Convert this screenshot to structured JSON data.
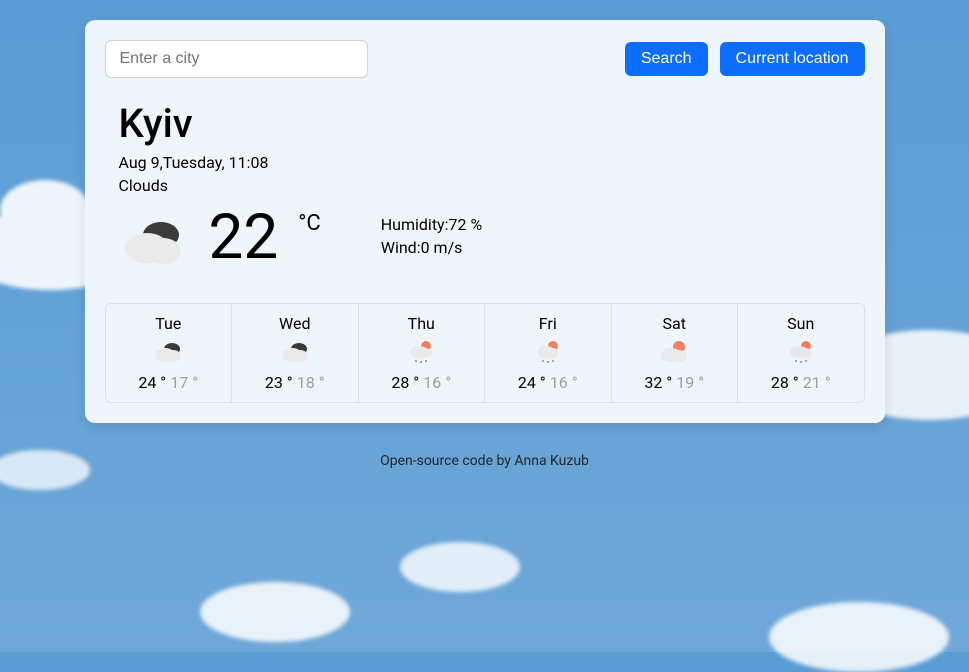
{
  "search": {
    "placeholder": "Enter a city",
    "search_button": "Search",
    "location_button": "Current location"
  },
  "current": {
    "city": "Kyiv",
    "date": "Aug 9,Tuesday, 11:08",
    "condition": "Clouds",
    "temp": "22",
    "unit": "°C",
    "humidity_label": "Humidity:",
    "humidity_value": "72 %",
    "wind_label": "Wind:",
    "wind_value": "0 m/s"
  },
  "forecast": [
    {
      "day": "Tue",
      "icon": "clouds",
      "high": "24 °",
      "low": "17 °"
    },
    {
      "day": "Wed",
      "icon": "clouds",
      "high": "23 °",
      "low": "18 °"
    },
    {
      "day": "Thu",
      "icon": "sun-rain",
      "high": "28 °",
      "low": "16 °"
    },
    {
      "day": "Fri",
      "icon": "sun-rain",
      "high": "24 °",
      "low": "16 °"
    },
    {
      "day": "Sat",
      "icon": "sun-cloud",
      "high": "32 °",
      "low": "19 °"
    },
    {
      "day": "Sun",
      "icon": "sun-rain",
      "high": "28 °",
      "low": "21 °"
    }
  ],
  "footer": "Open-source code by Anna Kuzub"
}
